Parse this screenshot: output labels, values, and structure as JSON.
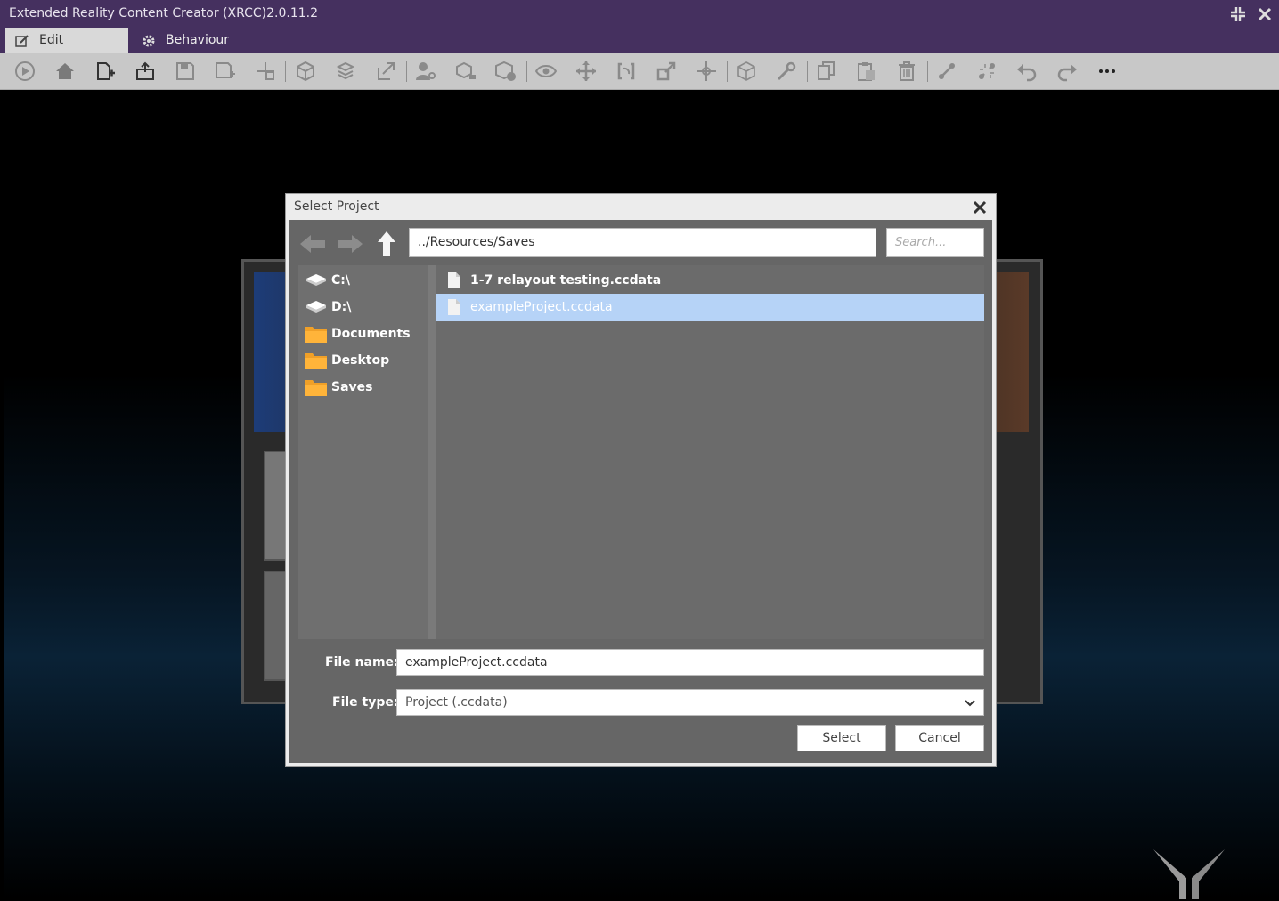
{
  "window": {
    "title": "Extended Reality Content Creator (XRCC)2.0.11.2",
    "minimize_icon": "collapse-icon",
    "close_icon": "close-icon"
  },
  "tabs": [
    {
      "label": "Edit",
      "icon": "edit-icon",
      "active": true
    },
    {
      "label": "Behaviour",
      "icon": "gear-icon",
      "active": false
    }
  ],
  "toolbar": {
    "buttons": [
      "play",
      "home",
      "new-file",
      "open-file",
      "save",
      "save-as",
      "import",
      "cube-1",
      "cube-2",
      "export",
      "settings-person",
      "cube-3",
      "cube-add",
      "view",
      "move",
      "rotate",
      "scale",
      "transform",
      "cube-outline",
      "wrench",
      "copy",
      "paste",
      "delete",
      "link",
      "unlink",
      "undo",
      "redo",
      "more"
    ]
  },
  "dialog": {
    "title": "Select Project",
    "path": "../Resources/Saves",
    "search_placeholder": "Search...",
    "places": [
      {
        "label": "C:\\",
        "icon": "drive-icon"
      },
      {
        "label": "D:\\",
        "icon": "drive-icon"
      },
      {
        "label": "Documents",
        "icon": "folder-icon"
      },
      {
        "label": "Desktop",
        "icon": "folder-icon"
      },
      {
        "label": "Saves",
        "icon": "folder-icon"
      }
    ],
    "files": [
      {
        "name": "1-7 relayout testing.ccdata",
        "selected": false
      },
      {
        "name": "exampleProject.ccdata",
        "selected": true
      }
    ],
    "file_name_label": "File name:",
    "file_name_value": "exampleProject.ccdata",
    "file_type_label": "File type:",
    "file_type_value": "Project (.ccdata)",
    "select_label": "Select",
    "cancel_label": "Cancel"
  },
  "colors": {
    "titlebar": "#45305f",
    "toolbar": "#c8c8c8",
    "selection": "#b6d3f7",
    "dialog_body": "#666666"
  }
}
